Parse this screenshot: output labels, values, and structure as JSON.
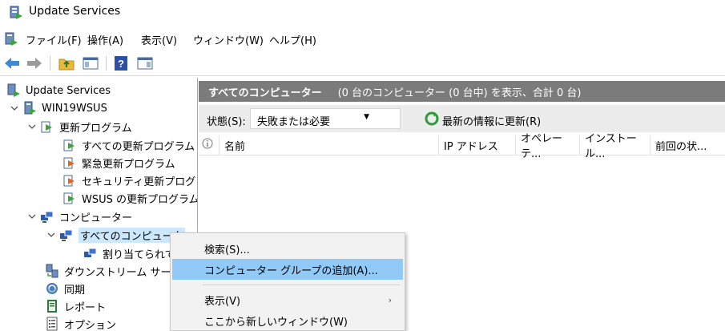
{
  "window": {
    "title": "Update Services"
  },
  "menubar": {
    "items": [
      "ファイル(F)",
      "操作(A)",
      "表示(V)",
      "ウィンドウ(W)",
      "ヘルプ(H)"
    ]
  },
  "toolbar": {
    "buttons": [
      "back-arrow-icon",
      "forward-arrow-icon",
      "up-folder-icon",
      "show-hide-pane-icon",
      "help-icon",
      "action-pane-icon"
    ]
  },
  "tree": {
    "root": "Update Services",
    "server": "WIN19WSUS",
    "updates": "更新プログラム",
    "update_children": [
      "すべての更新プログラム",
      "緊急更新プログラム",
      "セキュリティ更新プログラム",
      "WSUS の更新プログラム"
    ],
    "computers": "コンピューター",
    "all_computers": "すべてのコンピュータ",
    "unassigned": "割り当てられて",
    "downstream": "ダウンストリーム サーバー",
    "sync": "同期",
    "reports": "レポート",
    "options": "オプション"
  },
  "main": {
    "header_title": "すべてのコンピューター",
    "header_summary": "(0 台のコンピューター (0 台中) を表示、合計 0 台)",
    "status_label": "状態(S):",
    "status_value": "失敗または必要",
    "refresh_label": "最新の情報に更新(R)",
    "columns": [
      "名前",
      "IP アドレス",
      "オペレーテ...",
      "インストール...",
      "前回の状..."
    ]
  },
  "context_menu": {
    "items": [
      "検索(S)...",
      "コンピューター グループの追加(A)...",
      "表示(V)",
      "ここから新しいウィンドウ(W)"
    ],
    "highlighted": "コンピューター グループの追加(A)..."
  },
  "colors": {
    "header_bg": "#7b7b7b",
    "selection": "#cce8ff",
    "menu_highlight": "#91c9f7"
  }
}
